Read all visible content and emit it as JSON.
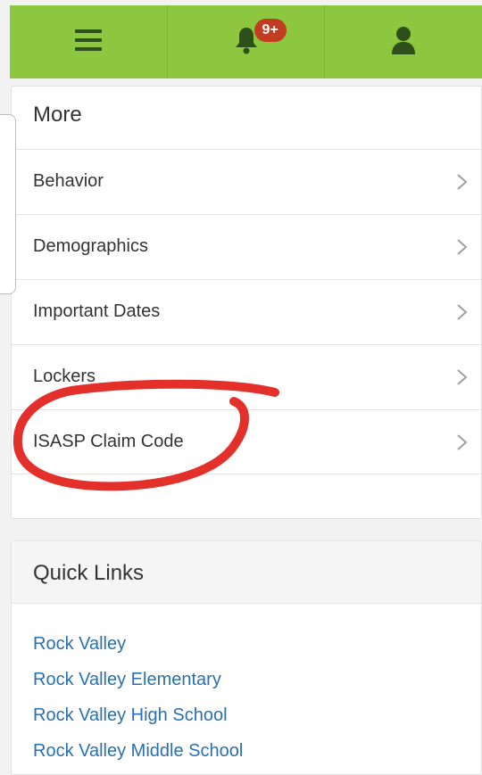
{
  "topbar": {
    "notification_badge": "9+",
    "brand_color": "#8dc63f",
    "icons": [
      "menu-icon",
      "bell-icon",
      "user-icon"
    ]
  },
  "more": {
    "title": "More",
    "items": [
      {
        "label": "Behavior"
      },
      {
        "label": "Demographics"
      },
      {
        "label": "Important Dates"
      },
      {
        "label": "Lockers"
      },
      {
        "label": "ISASP Claim Code"
      }
    ]
  },
  "quick_links": {
    "title": "Quick Links",
    "links": [
      {
        "label": "Rock Valley"
      },
      {
        "label": "Rock Valley Elementary"
      },
      {
        "label": "Rock Valley High School"
      },
      {
        "label": "Rock Valley Middle School"
      }
    ],
    "link_color": "#2a6fb0"
  },
  "annotation": {
    "color": "#e3302a"
  }
}
